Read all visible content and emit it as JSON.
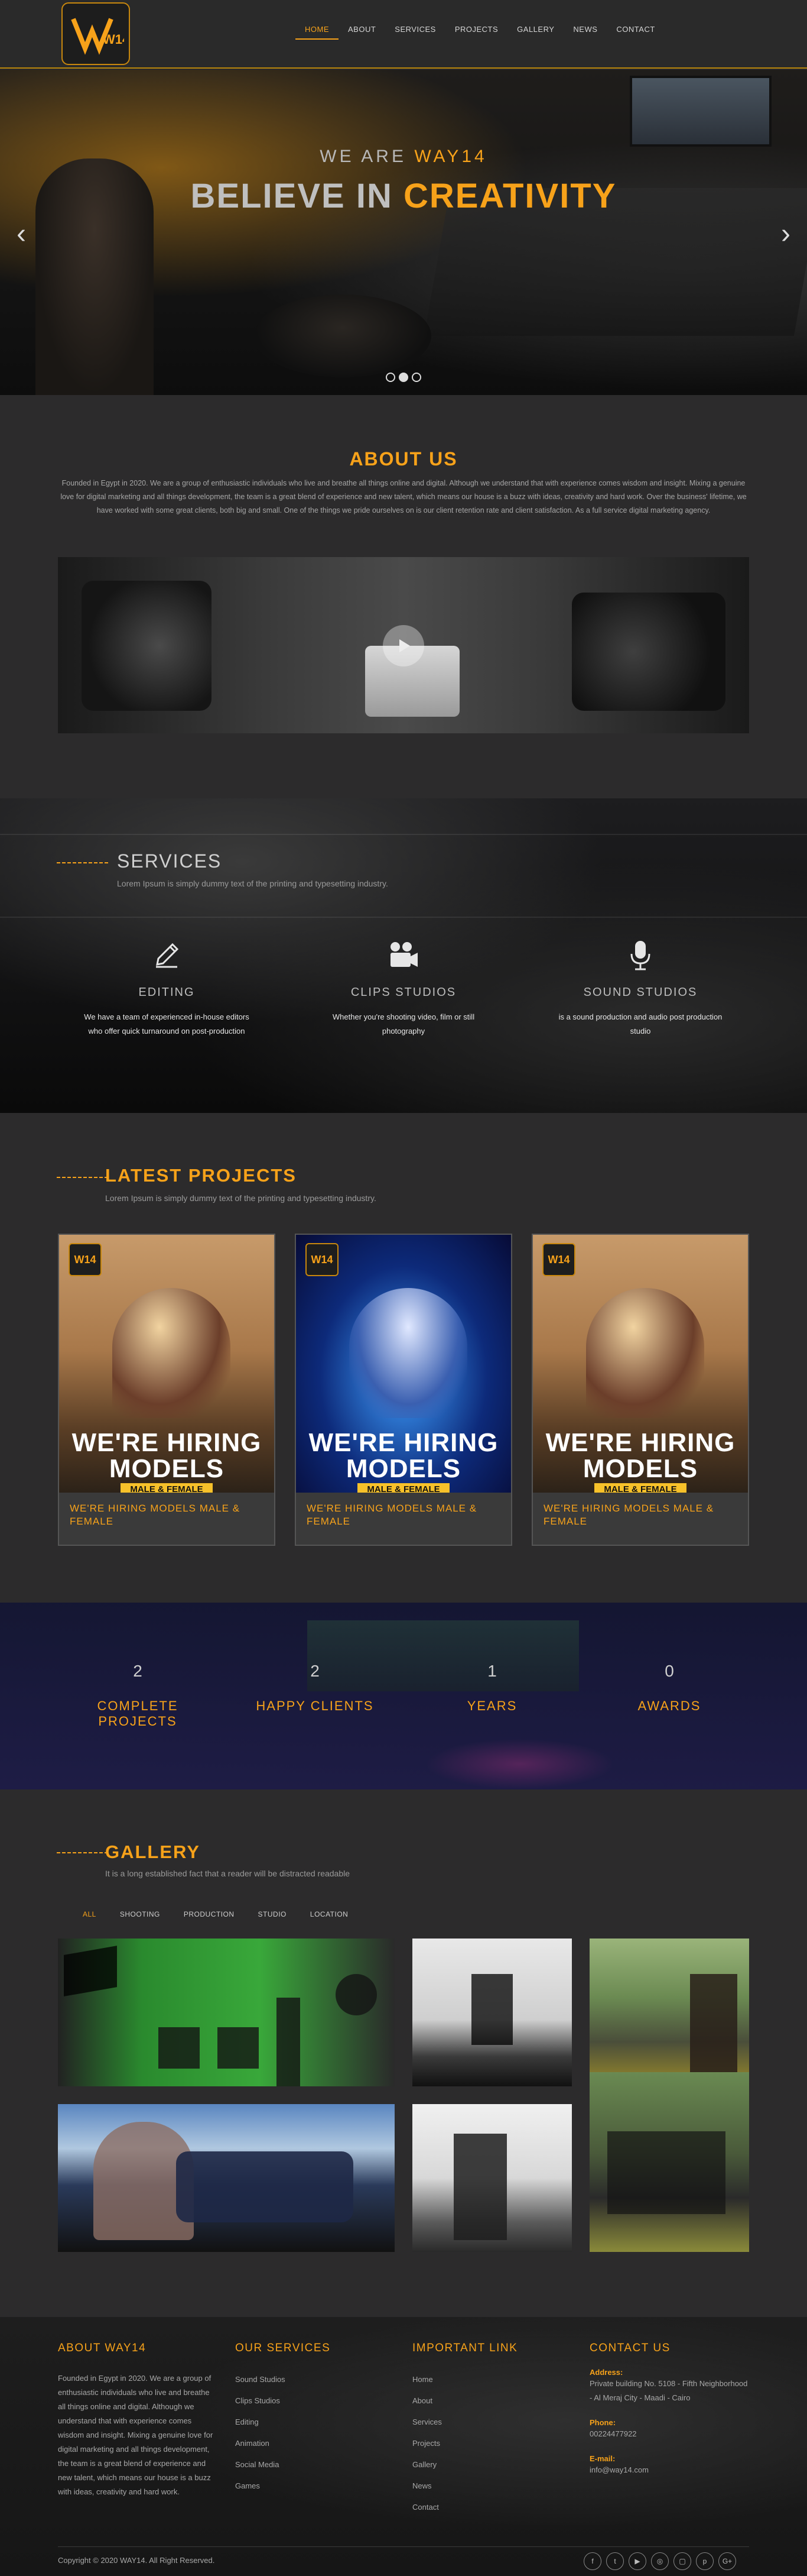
{
  "header": {
    "logo_text": "W14",
    "nav": [
      {
        "label": "HOME",
        "active": true
      },
      {
        "label": "ABOUT"
      },
      {
        "label": "SERVICES"
      },
      {
        "label": "PROJECTS"
      },
      {
        "label": "GALLERY"
      },
      {
        "label": "NEWS"
      },
      {
        "label": "CONTACT"
      }
    ]
  },
  "hero": {
    "sub_a": "WE ARE ",
    "sub_b": "WAY14",
    "title_a": "BELIEVE IN ",
    "title_b": "CREATIVITY",
    "prev_icon": "chevron-left-icon",
    "next_icon": "chevron-right-icon",
    "slides": 3,
    "active_slide": 2
  },
  "about": {
    "title": "ABOUT US",
    "text": "Founded in Egypt in 2020. We are a group of enthusiastic individuals who live and breathe all things online and digital. Although we understand that with experience comes wisdom and insight. Mixing a genuine love for digital marketing and all things development, the team is a great blend of experience and new talent, which means our house is a buzz with ideas, creativity and hard work. Over the business' lifetime, we have worked with some great clients, both big and small. One of the things we pride ourselves on is our client retention rate and client satisfaction. As a full service digital marketing agency.",
    "video_icon": "play-icon"
  },
  "services": {
    "title": "SERVICES",
    "lead": "Lorem Ipsum is simply dummy text of the printing and typesetting industry.",
    "items": [
      {
        "icon": "pencil-icon",
        "title": "EDITING",
        "text": "We have a team of experienced in-house editors who offer quick turnaround on post-production"
      },
      {
        "icon": "video-camera-icon",
        "title": "CLIPS STUDIOS",
        "text": "Whether you're shooting video, film or still photography"
      },
      {
        "icon": "microphone-icon",
        "title": "SOUND STUDIOS",
        "text": "is a sound production and audio post production studio"
      }
    ]
  },
  "projects": {
    "title": "LATEST PROJECTS",
    "lead": "Lorem Ipsum is simply dummy text of the printing and typesetting industry.",
    "items": [
      {
        "hire_1": "WE'RE HIRING",
        "hire_2": "MODELS",
        "tag": "MALE & FEMALE",
        "caption": "WE'RE HIRING MODELS MALE & FEMALE",
        "style": "warm"
      },
      {
        "hire_1": "WE'RE HIRING",
        "hire_2": "MODELS",
        "tag": "MALE & FEMALE",
        "caption": "WE'RE HIRING MODELS MALE & FEMALE",
        "style": "blue"
      },
      {
        "hire_1": "WE'RE HIRING",
        "hire_2": "MODELS",
        "tag": "MALE & FEMALE",
        "caption": "WE'RE HIRING MODELS MALE & FEMALE",
        "style": "warm"
      }
    ]
  },
  "counters": [
    {
      "value": "2",
      "label": "COMPLETE PROJECTS"
    },
    {
      "value": "2",
      "label": "HAPPY CLIENTS"
    },
    {
      "value": "1",
      "label": "YEARS"
    },
    {
      "value": "0",
      "label": "AWARDS"
    }
  ],
  "gallery": {
    "title": "GALLERY",
    "lead": "It is a long established fact that a reader will be distracted readable",
    "filters": [
      {
        "label": "ALL",
        "active": true
      },
      {
        "label": "SHOOTING"
      },
      {
        "label": "PRODUCTION"
      },
      {
        "label": "STUDIO"
      },
      {
        "label": "LOCATION"
      }
    ]
  },
  "footer": {
    "about": {
      "title": "ABOUT WAY14",
      "text": "Founded in Egypt in 2020. We are a group of enthusiastic individuals who live and breathe all things online and digital. Although we understand that with experience comes wisdom and insight. Mixing a genuine love for digital marketing and all things development, the team is a great blend of experience and new talent, which means our house is a buzz with ideas, creativity and hard work."
    },
    "services": {
      "title": "OUR SERVICES",
      "items": [
        "Sound Studios",
        "Clips Studios",
        "Editing",
        "Animation",
        "Social Media",
        "Games"
      ]
    },
    "links": {
      "title": "IMPORTANT LINK",
      "items": [
        "Home",
        "About",
        "Services",
        "Projects",
        "Gallery",
        "News",
        "Contact"
      ]
    },
    "contact": {
      "title": "CONTACT US",
      "address_label": "Address:",
      "address": "Private building No. 5108 - Fifth Neighborhood - Al Meraj City - Maadi - Cairo",
      "phone_label": "Phone:",
      "phone": "00224477922",
      "email_label": "E-mail:",
      "email": "info@way14.com"
    },
    "copyright": "Copyright © 2020 WAY14. All Right Reserved.",
    "social": [
      {
        "icon": "facebook-icon",
        "glyph": "f"
      },
      {
        "icon": "twitter-icon",
        "glyph": "t"
      },
      {
        "icon": "youtube-icon",
        "glyph": "▶"
      },
      {
        "icon": "instagram-icon",
        "glyph": "◎"
      },
      {
        "icon": "flickr-icon",
        "glyph": "▢"
      },
      {
        "icon": "pinterest-icon",
        "glyph": "p"
      },
      {
        "icon": "google-plus-icon",
        "glyph": "G+"
      }
    ]
  }
}
